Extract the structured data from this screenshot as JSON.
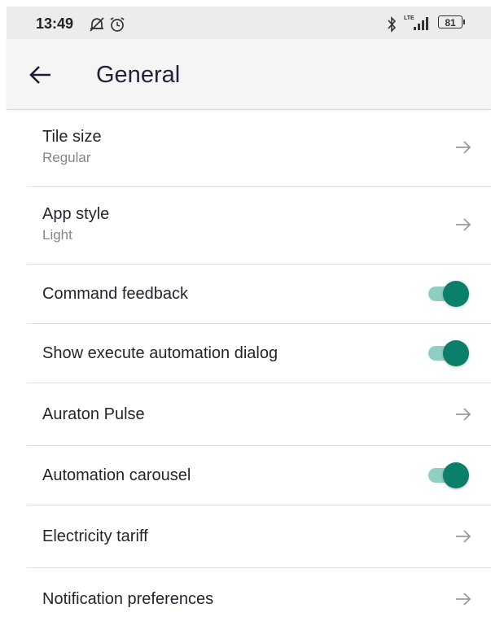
{
  "status_bar": {
    "time": "13:49",
    "network": "LTE",
    "battery": "81"
  },
  "header": {
    "title": "General"
  },
  "colors": {
    "accent": "#0a806b",
    "accent_track": "#8fcfc2"
  },
  "settings": [
    {
      "title": "Tile size",
      "subtitle": "Regular",
      "control": "chevron"
    },
    {
      "title": "App style",
      "subtitle": "Light",
      "control": "chevron"
    },
    {
      "title": "Command feedback",
      "control": "toggle",
      "on": true
    },
    {
      "title": "Show execute automation dialog",
      "control": "toggle",
      "on": true
    },
    {
      "title": "Auraton Pulse",
      "control": "chevron"
    },
    {
      "title": "Automation carousel",
      "control": "toggle",
      "on": true
    },
    {
      "title": "Electricity tariff",
      "control": "chevron"
    },
    {
      "title": "Notification preferences",
      "control": "chevron"
    }
  ]
}
